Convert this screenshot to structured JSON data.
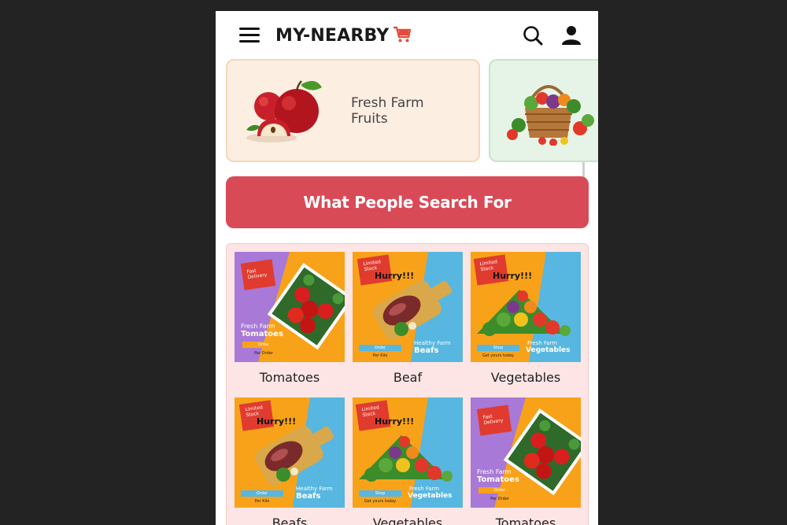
{
  "header": {
    "brand": "MY-NEARBY"
  },
  "categories": [
    {
      "label": "Fresh Farm Fruits"
    },
    {
      "label": ""
    }
  ],
  "banner": {
    "title": "What People Search For"
  },
  "products": [
    {
      "caption": "Tomatoes",
      "poster": {
        "badge": "Fast Delivery",
        "subline": "Fresh Farm",
        "headline": "Tomatoes",
        "cta": "Order",
        "note": "Per Order"
      }
    },
    {
      "caption": "Beaf",
      "poster": {
        "badge": "Limited Stock",
        "hurry": "Hurry!!!",
        "subline": "Healthy Farm",
        "headline": "Beafs",
        "cta": "Order",
        "note": "Per Kilo"
      }
    },
    {
      "caption": "Vegetables",
      "poster": {
        "badge": "Limited Stock",
        "hurry": "Hurry!!!",
        "subline": "Fresh Farm",
        "headline": "Vegetables",
        "cta": "Shop",
        "note": "Get yours today"
      }
    },
    {
      "caption": "Beafs",
      "poster": {
        "badge": "Limited Stock",
        "hurry": "Hurry!!!",
        "subline": "Healthy Farm",
        "headline": "Beafs",
        "cta": "Order",
        "note": "Per Kilo"
      }
    },
    {
      "caption": "Vegetables",
      "poster": {
        "badge": "Limited Stock",
        "hurry": "Hurry!!!",
        "subline": "Fresh Farm",
        "headline": "Vegetables",
        "cta": "Shop",
        "note": "Get yours today"
      }
    },
    {
      "caption": "Tomatoes",
      "poster": {
        "badge": "Fast Delivery",
        "subline": "Fresh Farm",
        "headline": "Tomatoes",
        "cta": "Order",
        "note": "Per Order"
      }
    }
  ],
  "icons": {
    "menu": "hamburger-menu-icon",
    "cart": "shopping-cart-icon",
    "search": "search-icon",
    "user": "user-icon"
  },
  "colors": {
    "banner": "#d94a57",
    "brand_cart": "#e64a3b",
    "grid_background": "#fde5e5",
    "fruits_card": "#fdeee2",
    "vegetables_card": "#e6f4e7",
    "poster_orange": "#f8a21a",
    "poster_blue": "#57b7e0",
    "poster_purple": "#a879d6",
    "poster_red": "#e03b2e"
  }
}
